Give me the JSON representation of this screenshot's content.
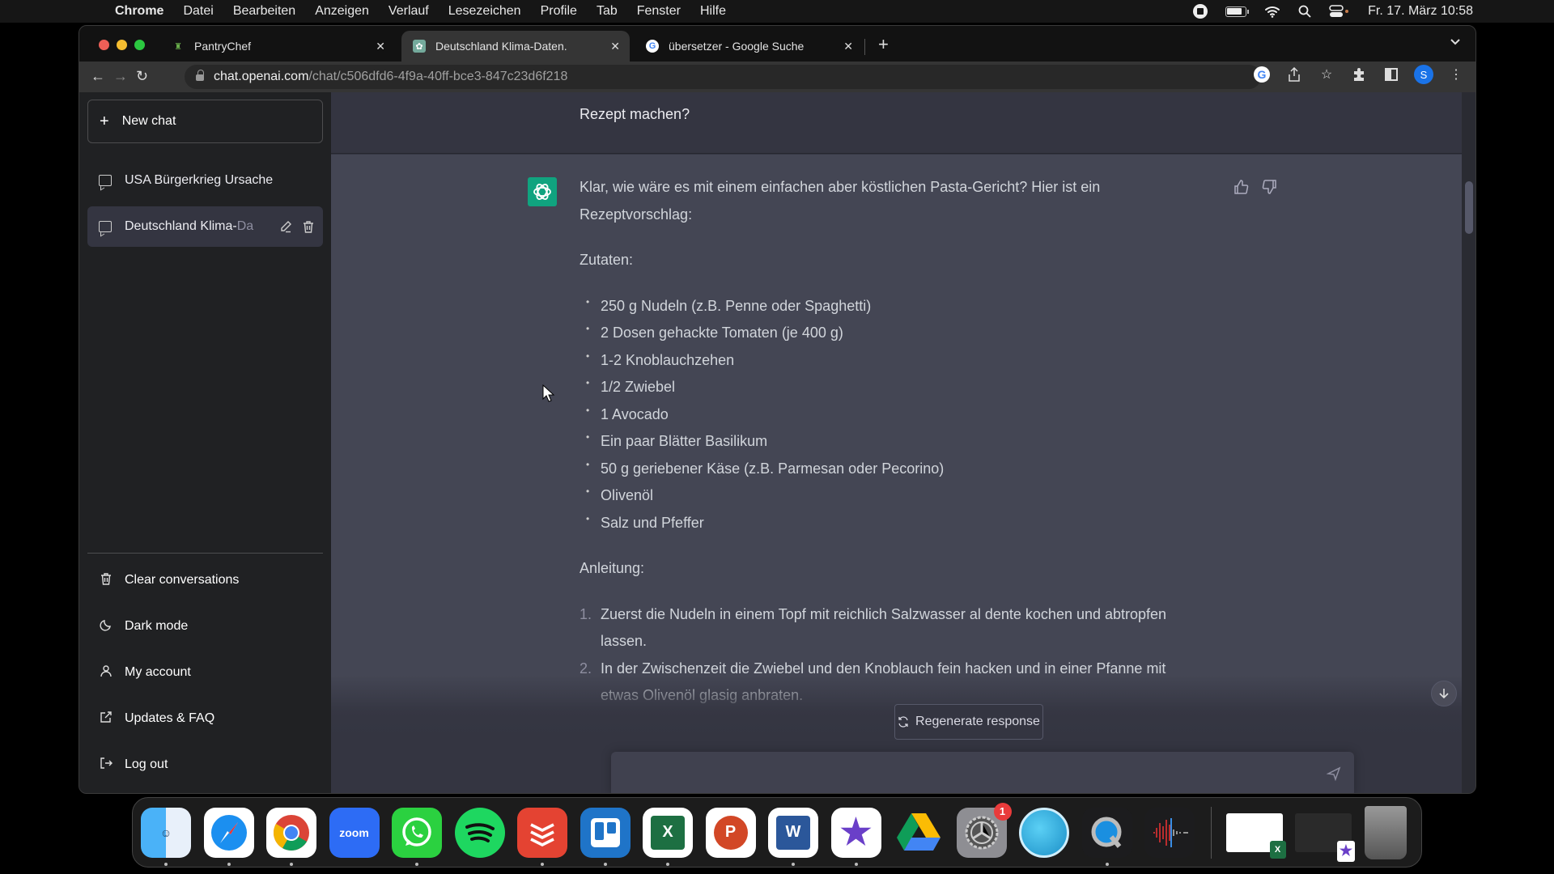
{
  "menubar": {
    "apple_icon": "apple-icon",
    "app_name": "Chrome",
    "items": [
      "Datei",
      "Bearbeiten",
      "Anzeigen",
      "Verlauf",
      "Lesezeichen",
      "Profile",
      "Tab",
      "Fenster",
      "Hilfe"
    ],
    "status_icons": [
      "screen-record-icon",
      "battery-icon",
      "wifi-icon",
      "spotlight-search-icon",
      "control-center-icon"
    ],
    "datetime": "Fr. 17. März  10:58"
  },
  "browser": {
    "tabs": [
      {
        "title": "PantryChef",
        "favicon": "pantrychef-icon",
        "active": false
      },
      {
        "title": "Deutschland Klima-Daten.",
        "favicon": "chatgpt-icon",
        "active": true
      },
      {
        "title": "übersetzer - Google Suche",
        "favicon": "google-icon",
        "active": false
      }
    ],
    "close_glyph": "✕",
    "new_tab_glyph": "+",
    "tab_menu_glyph": "⌄",
    "nav": {
      "back": "←",
      "forward": "→",
      "reload": "↻"
    },
    "url_host": "chat.openai.com",
    "url_path": "/chat/c506dfd6-4f9a-40ff-bce3-847c23d6f218",
    "profile_initial": "S"
  },
  "sidebar": {
    "new_chat_label": "New chat",
    "conversations": [
      {
        "title": "USA Bürgerkrieg Ursache",
        "active": false
      },
      {
        "title_visible": "Deutschland Klima-",
        "title_faded": "Da",
        "active": true
      }
    ],
    "footer_items": [
      {
        "label": "Clear conversations",
        "icon": "trash-icon"
      },
      {
        "label": "Dark mode",
        "icon": "moon-icon"
      },
      {
        "label": "My account",
        "icon": "user-icon"
      },
      {
        "label": "Updates & FAQ",
        "icon": "external-link-icon"
      },
      {
        "label": "Log out",
        "icon": "logout-icon"
      }
    ]
  },
  "chat": {
    "user_message_tail": "Rezept machen?",
    "assistant": {
      "intro": "Klar, wie wäre es mit einem einfachen aber köstlichen Pasta-Gericht? Hier ist ein Rezeptvorschlag:",
      "ingredients_heading": "Zutaten:",
      "ingredients": [
        "250 g Nudeln (z.B. Penne oder Spaghetti)",
        "2 Dosen gehackte Tomaten (je 400 g)",
        "1-2 Knoblauchzehen",
        "1/2 Zwiebel",
        "1 Avocado",
        "Ein paar Blätter Basilikum",
        "50 g geriebener Käse (z.B. Parmesan oder Pecorino)",
        "Olivenöl",
        "Salz und Pfeffer"
      ],
      "steps_heading": "Anleitung:",
      "steps": [
        {
          "num": "1.",
          "text": "Zuerst die Nudeln in einem Topf mit reichlich Salzwasser al dente kochen und abtropfen lassen."
        },
        {
          "num": "2.",
          "text": "In der Zwischenzeit die Zwiebel und den Knoblauch fein hacken und in einer Pfanne mit etwas Olivenöl glasig anbraten."
        }
      ]
    },
    "regenerate_label": "Regenerate response",
    "input_placeholder": "",
    "input_value": ""
  },
  "dock": {
    "apps": [
      {
        "name": "Finder",
        "running": true
      },
      {
        "name": "Safari",
        "running": true
      },
      {
        "name": "Chrome",
        "running": true
      },
      {
        "name": "Zoom",
        "label": "zoom",
        "running": false
      },
      {
        "name": "WhatsApp",
        "running": true
      },
      {
        "name": "Spotify",
        "running": false
      },
      {
        "name": "Todoist",
        "running": true
      },
      {
        "name": "Trello",
        "running": true
      },
      {
        "name": "Excel",
        "label": "X",
        "running": true
      },
      {
        "name": "PowerPoint",
        "label": "P",
        "running": false
      },
      {
        "name": "Word",
        "label": "W",
        "running": true
      },
      {
        "name": "iMovie",
        "running": true
      },
      {
        "name": "Google Drive",
        "running": false
      },
      {
        "name": "System Settings",
        "badge": "1",
        "running": false
      },
      {
        "name": "Mirror",
        "running": false
      },
      {
        "name": "QuickTime Player",
        "running": true
      },
      {
        "name": "Voice Memos",
        "running": false
      }
    ],
    "trash": "Trash"
  },
  "colors": {
    "accent_green": "#10a37f",
    "sidebar_bg": "#202123",
    "chat_bg": "#343541",
    "assistant_bg": "#444654"
  }
}
